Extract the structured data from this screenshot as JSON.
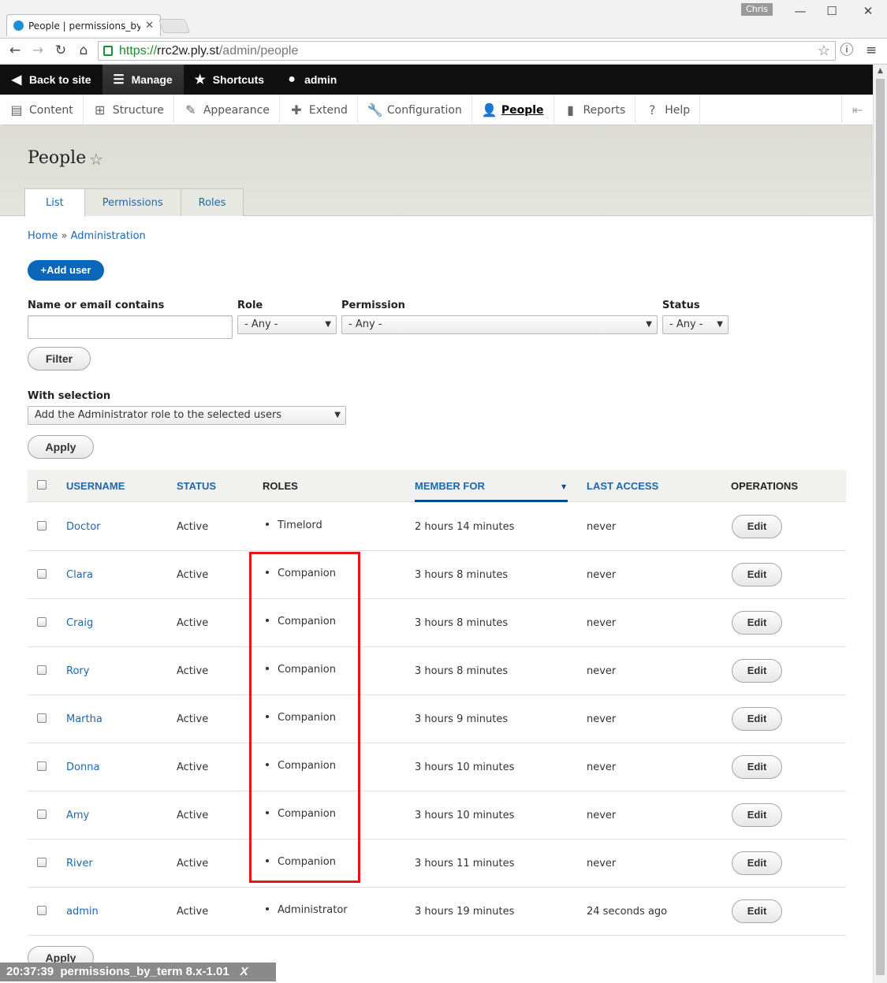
{
  "browser": {
    "tab_title": "People | permissions_by_te",
    "profile": "Chris",
    "url_scheme": "https://",
    "url_host": "rrc2w.ply.st",
    "url_path": "/admin/people",
    "secure_color": "#1e8c2e"
  },
  "toolbar": {
    "back": "Back to site",
    "manage": "Manage",
    "shortcuts": "Shortcuts",
    "user": "admin",
    "background": "#0f0f0f"
  },
  "tray": {
    "items": [
      "Content",
      "Structure",
      "Appearance",
      "Extend",
      "Configuration",
      "People",
      "Reports",
      "Help"
    ],
    "active": "People"
  },
  "page": {
    "title": "People",
    "tabs": [
      "List",
      "Permissions",
      "Roles"
    ],
    "breadcrumb": [
      "Home",
      "Administration"
    ],
    "breadcrumb_sep": "»",
    "add_user": "Add user",
    "accent": "#0a66b8"
  },
  "filters": {
    "name_label": "Name or email contains",
    "name_value": "",
    "role_label": "Role",
    "role_value": "- Any -",
    "permission_label": "Permission",
    "permission_value": "- Any -",
    "status_label": "Status",
    "status_value": "- Any -",
    "filter_button": "Filter"
  },
  "bulk": {
    "label": "With selection",
    "value": "Add the Administrator role to the selected users",
    "apply": "Apply"
  },
  "table": {
    "headers": {
      "username": "USERNAME",
      "status": "STATUS",
      "roles": "ROLES",
      "member_for": "MEMBER FOR",
      "last_access": "LAST ACCESS",
      "operations": "OPERATIONS"
    },
    "rows": [
      {
        "username": "Doctor",
        "status": "Active",
        "role": "Timelord",
        "member_for": "2 hours 14 minutes",
        "last_access": "never",
        "op": "Edit"
      },
      {
        "username": "Clara",
        "status": "Active",
        "role": "Companion",
        "member_for": "3 hours 8 minutes",
        "last_access": "never",
        "op": "Edit"
      },
      {
        "username": "Craig",
        "status": "Active",
        "role": "Companion",
        "member_for": "3 hours 8 minutes",
        "last_access": "never",
        "op": "Edit"
      },
      {
        "username": "Rory",
        "status": "Active",
        "role": "Companion",
        "member_for": "3 hours 8 minutes",
        "last_access": "never",
        "op": "Edit"
      },
      {
        "username": "Martha",
        "status": "Active",
        "role": "Companion",
        "member_for": "3 hours 9 minutes",
        "last_access": "never",
        "op": "Edit"
      },
      {
        "username": "Donna",
        "status": "Active",
        "role": "Companion",
        "member_for": "3 hours 10 minutes",
        "last_access": "never",
        "op": "Edit"
      },
      {
        "username": "Amy",
        "status": "Active",
        "role": "Companion",
        "member_for": "3 hours 10 minutes",
        "last_access": "never",
        "op": "Edit"
      },
      {
        "username": "River",
        "status": "Active",
        "role": "Companion",
        "member_for": "3 hours 11 minutes",
        "last_access": "never",
        "op": "Edit"
      },
      {
        "username": "admin",
        "status": "Active",
        "role": "Administrator",
        "member_for": "3 hours 19 minutes",
        "last_access": "24 seconds ago",
        "op": "Edit"
      }
    ]
  },
  "bottom_apply": "Apply",
  "overlay": {
    "time": "20:37:39",
    "label": "permissions_by_term 8.x-1.01",
    "close": "X"
  },
  "highlight_color": "#e8141c"
}
